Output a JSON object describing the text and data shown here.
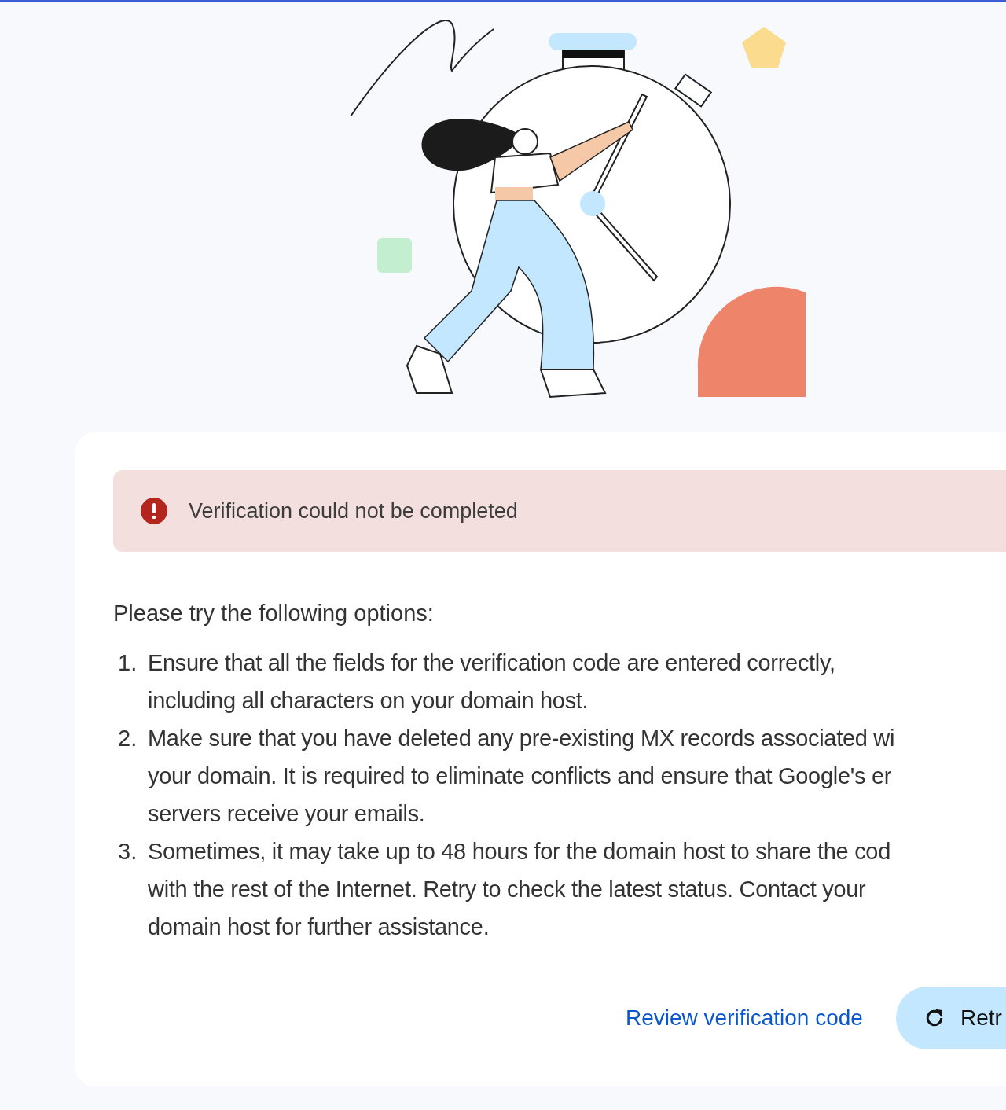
{
  "alert": {
    "message": "Verification could not be completed"
  },
  "intro": "Please try the following options:",
  "options": [
    {
      "number": "1.",
      "text": "Ensure that all the fields for the verification code are entered correctly,\nincluding all characters on your domain host."
    },
    {
      "number": "2.",
      "text": "Make sure that you have deleted any pre-existing MX records associated wi\nyour domain. It is required to eliminate conflicts and ensure that Google's er\nservers receive your emails."
    },
    {
      "number": "3.",
      "text": "Sometimes, it may take up to 48 hours for the domain host to share the cod\nwith the rest of the Internet. Retry to check the latest status. Contact your\ndomain host for further assistance."
    }
  ],
  "actions": {
    "link": "Review verification code",
    "button": "Retr"
  }
}
